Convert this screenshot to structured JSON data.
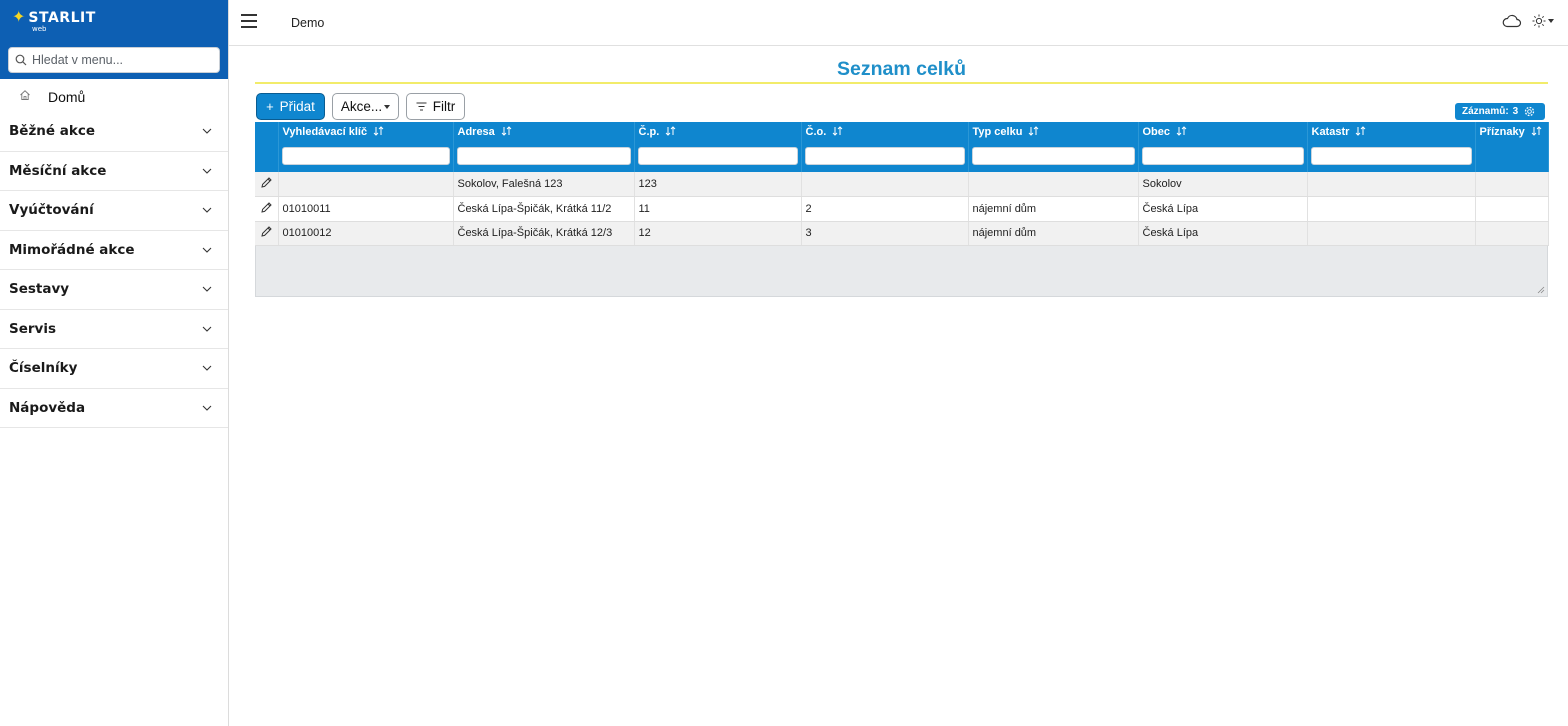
{
  "brand": {
    "name": "STARLIT",
    "sub": "web"
  },
  "search": {
    "placeholder": "Hledat v menu..."
  },
  "home": {
    "label": "Domů"
  },
  "menu": {
    "items": [
      {
        "label": "Běžné akce"
      },
      {
        "label": "Měsíční akce"
      },
      {
        "label": "Vyúčtování"
      },
      {
        "label": "Mimořádné akce"
      },
      {
        "label": "Sestavy"
      },
      {
        "label": "Servis"
      },
      {
        "label": "Číselníky"
      },
      {
        "label": "Nápověda"
      }
    ]
  },
  "topbar": {
    "title": "Demo"
  },
  "page": {
    "title": "Seznam celků"
  },
  "toolbar": {
    "add_label": "Přidat",
    "actions_label": "Akce...",
    "filter_label": "Filtr"
  },
  "records": {
    "label": "Záznamů:",
    "count": "3"
  },
  "table": {
    "columns": [
      "Vyhledávací klíč",
      "Adresa",
      "Č.p.",
      "Č.o.",
      "Typ celku",
      "Obec",
      "Katastr",
      "Příznaky"
    ],
    "rows": [
      [
        "",
        "Sokolov, Falešná 123",
        "123",
        "",
        "",
        "Sokolov",
        "",
        ""
      ],
      [
        "01010011",
        "Česká Lípa-Špičák, Krátká 11/2",
        "11",
        "2",
        "nájemní dům",
        "Česká Lípa",
        "",
        ""
      ],
      [
        "01010012",
        "Česká Lípa-Špičák, Krátká 12/3",
        "12",
        "3",
        "nájemní dům",
        "Česká Lípa",
        "",
        ""
      ]
    ]
  },
  "colors": {
    "brand_blue": "#0d5fb3",
    "accent_blue": "#0f86cf",
    "title_blue": "#1f8fc9",
    "rule_yellow": "#f2ec6a",
    "star_yellow": "#f5d623"
  }
}
